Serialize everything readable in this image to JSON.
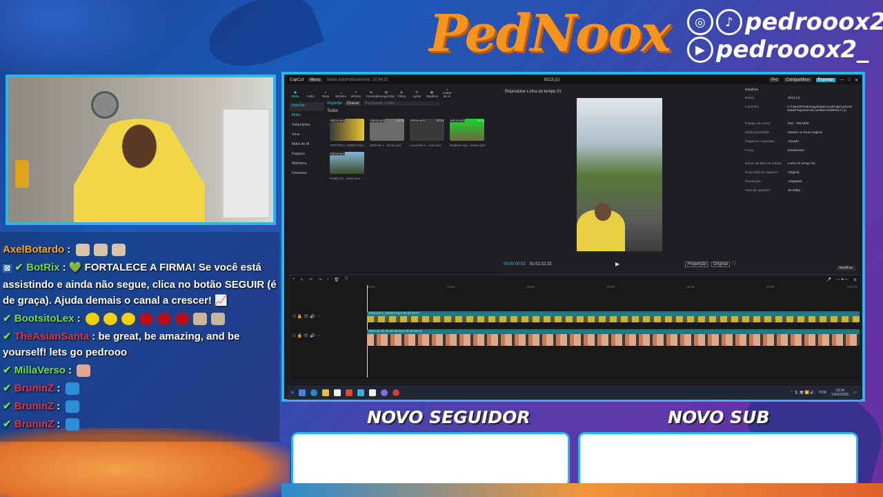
{
  "branding": {
    "logo": "PedNoox",
    "instagram_handle": "",
    "tiktok_handle": "pedrooox2_",
    "youtube_handle": "pedrooox2_"
  },
  "colors": {
    "accent": "#2ab6e8",
    "logo": "#f7941d",
    "chat_green": "#6fdc5a",
    "chat_red": "#e0354a"
  },
  "chat": [
    {
      "user": "AxelBotardo",
      "user_color": "#f5a524",
      "message": ""
    },
    {
      "user": "BotRix",
      "user_color": "#6fdc5a",
      "message": "💚 FORTALECE A FIRMA! Se você está assistindo e ainda não segue, clica no botão SEGUIR (é de graça). Ajuda demais o canal a crescer! 📈"
    },
    {
      "user": "BootsitoLex",
      "user_color": "#6fdc5a",
      "message": ""
    },
    {
      "user": "TheAsianSanta",
      "user_color": "#e0354a",
      "message": "be great, be amazing, and be yourself! lets go pedrooo"
    },
    {
      "user": "MillaVerso",
      "user_color": "#6fdc5a",
      "message": ""
    },
    {
      "user": "BruninZ",
      "user_color": "#e0354a",
      "message": ""
    },
    {
      "user": "BruninZ",
      "user_color": "#e0354a",
      "message": ""
    },
    {
      "user": "BruninZ",
      "user_color": "#e0354a",
      "message": ""
    }
  ],
  "editor": {
    "app_name": "CapCut",
    "menu": "Menu",
    "autosave": "Salvo automaticamente: 13:34:22",
    "project": "0213 (1)",
    "pro": "Pro",
    "share": "Compartilhar",
    "export": "Exportar",
    "tools": [
      "Mídia",
      "Áudio",
      "Texto",
      "Stickers",
      "Efeitos",
      "Transições",
      "Legendas",
      "Filtros",
      "Ajuste",
      "Modelos",
      "Avatar de IA"
    ],
    "leftnav": [
      "Importar",
      "Mídia",
      "Subprojetos",
      "Seus",
      "Mídia de IA",
      "Espaços",
      "Biblioteca",
      "Dreamina"
    ],
    "import_btn": "Importar",
    "record_btn": "Gravar",
    "search_placeholder": "Pesquisar mídia",
    "all_label": "Todos",
    "thumbs": [
      {
        "tag": "Adicionado",
        "dur": "",
        "name": "2026-0213_160024.mp4"
      },
      {
        "tag": "Adicionado",
        "dur": "03:35",
        "name": "2026-02-1...00-36.mp4"
      },
      {
        "tag": "Adicionado",
        "dur": "00:21",
        "name": "Leonardo D...rical.mp4"
      },
      {
        "tag": "Adicionado",
        "dur": "00:11",
        "name": "Realistic exp...shorts.mp4"
      },
      {
        "tag": "Adicionado",
        "dur": "",
        "name": "Reality sh...camp.mp4"
      }
    ],
    "player_title": "Reprodutor-Linha do tempo 01",
    "time_current": "00:00:00:02",
    "time_total": "01:02:32:23",
    "player_buttons": [
      "Proporção",
      "Original"
    ],
    "details_title": "Detalhes",
    "details": [
      {
        "k": "Nome:",
        "v": "0213 (1)"
      },
      {
        "k": "Caminho:",
        "v": "C:/Users/Pedro/AppData/Local/CapCut/User Data/Projects/com.lveditor.draft/0213 (1)"
      },
      {
        "k": "Espaço de cores:",
        "v": "Rec. 709 SDR"
      },
      {
        "k": "Mídia importada:",
        "v": "Manter no local original"
      },
      {
        "k": "Organizar camadas:",
        "v": "Ativado"
      },
      {
        "k": "Proxy:",
        "v": "Desativado"
      },
      {
        "k": "Nome da linha do tempo:",
        "v": "Linha do tempo 01"
      },
      {
        "k": "Proporção do aspecto:",
        "v": "Original"
      },
      {
        "k": "Resolução:",
        "v": "Adaptado"
      },
      {
        "k": "Taxa de quadros:",
        "v": "30.00fps"
      }
    ],
    "modify_btn": "Modificar",
    "ruler": [
      "00:00",
      "10:00",
      "20:00",
      "30:00",
      "40:00",
      "50:00",
      "1:00:00"
    ],
    "track1_label": "2026-0213_160024.mp4  00:33:43:07",
    "track2_label": "2026-02-13 16-00-36.mp4  00:32:49:04",
    "clock_time": "13:34",
    "clock_date": "14/02/2026",
    "lang": "POR"
  },
  "alerts": {
    "follower_title": "NOVO SEGUIDOR",
    "sub_title": "NOVO SUB"
  }
}
